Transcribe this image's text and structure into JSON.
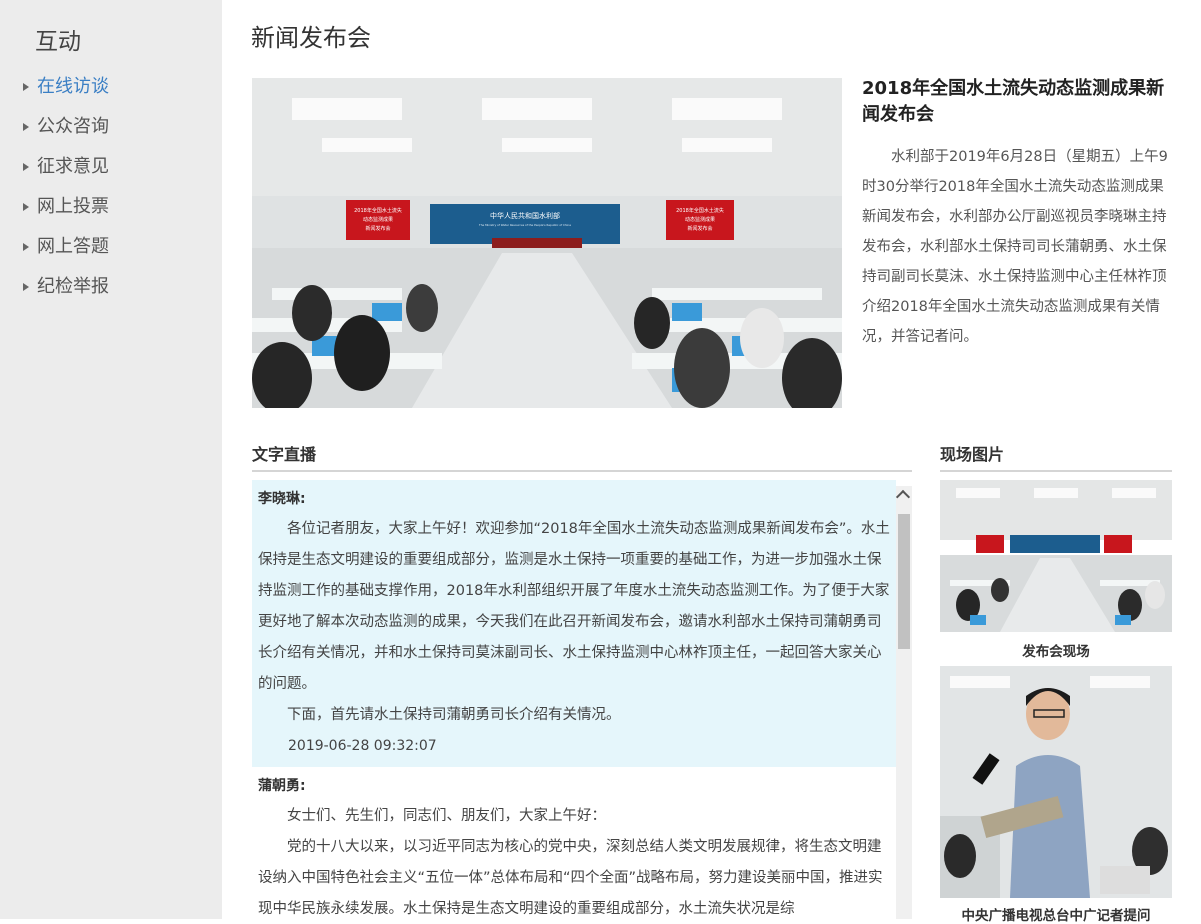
{
  "sidebar": {
    "title": "互动",
    "items": [
      {
        "label": "在线访谈"
      },
      {
        "label": "公众咨询"
      },
      {
        "label": "征求意见"
      },
      {
        "label": "网上投票"
      },
      {
        "label": "网上答题"
      },
      {
        "label": "纪检举报"
      }
    ]
  },
  "main": {
    "page_title": "新闻发布会",
    "headline": "2018年全国水土流失动态监测成果新闻发布会",
    "summary": "水利部于2019年6月28日（星期五）上午9时30分举行2018年全国水土流失动态监测成果新闻发布会，水利部办公厅副巡视员李晓琳主持发布会，水利部水土保持司司长蒲朝勇、水土保持司副司长莫沫、水土保持监测中心主任林祚顶介绍2018年全国水土流失动态监测成果有关情况，并答记者问。",
    "hero_banner": {
      "center": "中华人民共和国水利部",
      "center_en": "The Ministry of Water Resources of the People's Republic of China",
      "side_line1": "2018年全国水土流失",
      "side_line2": "动态监测成果",
      "side_line3": "新闻发布会"
    }
  },
  "live": {
    "heading": "文字直播",
    "entries": [
      {
        "speaker": "李晓琳:",
        "paragraphs": [
          "各位记者朋友，大家上午好！欢迎参加“2018年全国水土流失动态监测成果新闻发布会”。水土保持是生态文明建设的重要组成部分，监测是水土保持一项重要的基础工作，为进一步加强水土保持监测工作的基础支撑作用，2018年水利部组织开展了年度水土流失动态监测工作。为了便于大家更好地了解本次动态监测的成果，今天我们在此召开新闻发布会，邀请水利部水土保持司蒲朝勇司长介绍有关情况，并和水土保持司莫沫副司长、水土保持监测中心林祚顶主任，一起回答大家关心的问题。",
          "下面，首先请水土保持司蒲朝勇司长介绍有关情况。"
        ],
        "time": "2019-06-28 09:32:07"
      },
      {
        "speaker": "蒲朝勇:",
        "paragraphs": [
          "女士们、先生们，同志们、朋友们，大家上午好：",
          "党的十八大以来，以习近平同志为核心的党中央，深刻总结人类文明发展规律，将生态文明建设纳入中国特色社会主义“五位一体”总体布局和“四个全面”战略布局，努力建设美丽中国，推进实现中华民族永续发展。水土保持是生态文明建设的重要组成部分，水土流失状况是综"
        ]
      }
    ]
  },
  "photos": {
    "heading": "现场图片",
    "items": [
      {
        "caption": "发布会现场"
      },
      {
        "caption": "中央广播电视总台中广记者提问"
      }
    ]
  },
  "colors": {
    "sidebar_bg": "#ececec",
    "active_nav": "#3b7fc4",
    "live_highlight": "#e5f6fb",
    "banner_red": "#c8161d",
    "banner_blue": "#1c5d8e"
  }
}
